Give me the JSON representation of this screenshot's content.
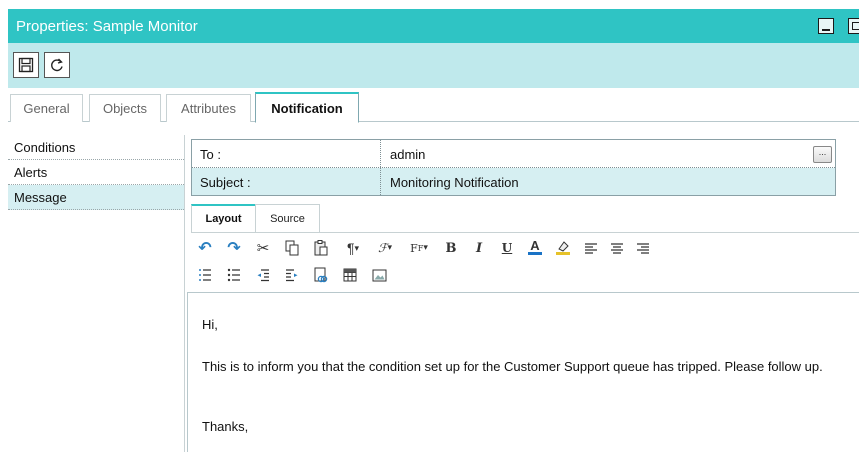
{
  "window": {
    "title": "Properties: Sample Monitor"
  },
  "toolbar": {
    "save_icon": "save-icon",
    "refresh_icon": "refresh-icon"
  },
  "tabs": [
    {
      "label": "General",
      "active": false
    },
    {
      "label": "Objects",
      "active": false
    },
    {
      "label": "Attributes",
      "active": false
    },
    {
      "label": "Notification",
      "active": true
    }
  ],
  "sidebar": {
    "items": [
      {
        "label": "Conditions",
        "active": false
      },
      {
        "label": "Alerts",
        "active": false
      },
      {
        "label": "Message",
        "active": true
      }
    ]
  },
  "fields": {
    "to": {
      "label": "To :",
      "value": "admin",
      "button_label": "..."
    },
    "subject": {
      "label": "Subject :",
      "value": "Monitoring Notification"
    }
  },
  "editor_tabs": [
    {
      "label": "Layout",
      "active": true
    },
    {
      "label": "Source",
      "active": false
    }
  ],
  "format_toolbar": {
    "row1": [
      "undo-icon",
      "redo-icon",
      "cut-icon",
      "copy-icon",
      "paste-icon",
      "paragraph-format-icon",
      "font-name-icon",
      "font-size-icon",
      "bold-icon",
      "italic-icon",
      "underline-icon",
      "font-color-icon",
      "highlight-color-icon",
      "align-left-icon",
      "align-center-icon",
      "align-right-icon"
    ],
    "row2": [
      "numbered-list-icon",
      "bulleted-list-icon",
      "outdent-icon",
      "indent-icon",
      "insert-link-icon",
      "insert-table-icon",
      "insert-image-icon"
    ]
  },
  "message": {
    "greeting": "Hi,",
    "body": "This is to inform you that the condition set up for the Customer Support queue has tripped. Please follow up.",
    "closing": "Thanks,"
  },
  "colors": {
    "accent": "#2fc4c4",
    "toolbar_bg": "#bfe9ec",
    "selected_row": "#d6eff2"
  }
}
